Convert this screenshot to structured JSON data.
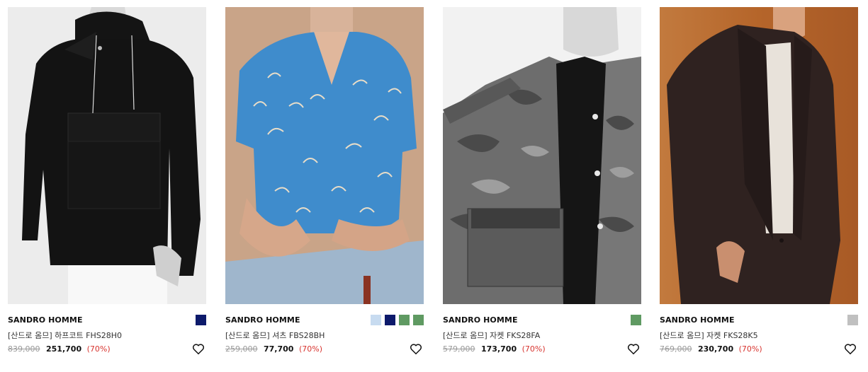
{
  "products": [
    {
      "brand": "SANDRO HOMME",
      "name": "[산드로 옴므] 하프코트 FHS28H0",
      "original_price": "839,000",
      "sale_price": "251,700",
      "discount": "(70%)",
      "swatches": [
        "#0d1a6b"
      ],
      "image": "black hooded anorak"
    },
    {
      "brand": "SANDRO HOMME",
      "name": "[산드로 옴므] 셔츠 FBS28BH",
      "original_price": "259,000",
      "sale_price": "77,700",
      "discount": "(70%)",
      "swatches": [
        "#c7dbf0",
        "#0d1a6b",
        "#5f9a62",
        "#5f9a62"
      ],
      "image": "blue printed short-sleeve shirt"
    },
    {
      "brand": "SANDRO HOMME",
      "name": "[산드로 옴므] 자켓 FKS28FA",
      "original_price": "579,000",
      "sale_price": "173,700",
      "discount": "(70%)",
      "swatches": [
        "#5f9a62"
      ],
      "image": "camouflage jacket"
    },
    {
      "brand": "SANDRO HOMME",
      "name": "[산드로 옴므] 자켓 FKS28K5",
      "original_price": "769,000",
      "sale_price": "230,700",
      "discount": "(70%)",
      "swatches": [
        "#c0c0c0"
      ],
      "image": "dark brown blazer"
    }
  ]
}
